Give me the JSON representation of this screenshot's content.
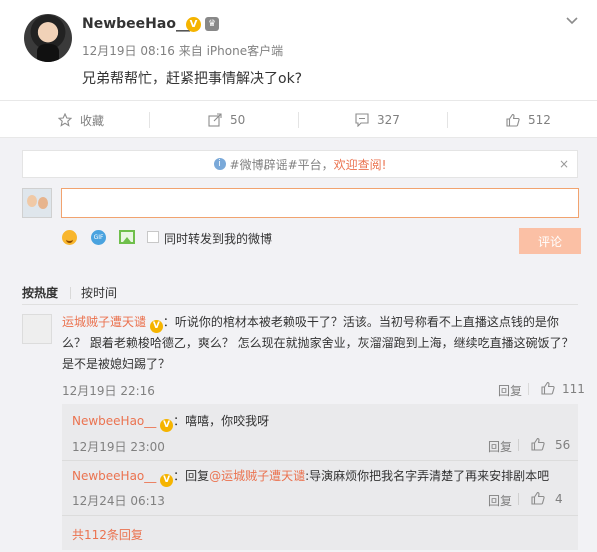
{
  "post": {
    "author": "NewbeeHao__",
    "verified_badge": "V",
    "level_badge": "♛",
    "meta": "12月19日 08:16 来自 iPhone客户端",
    "text": "兄弟帮帮忙，赶紧把事情解决了ok?",
    "more_icon": "chevron-down-icon"
  },
  "actions": {
    "favorite_label": "收藏",
    "repost_count": "50",
    "comment_count": "327",
    "like_count": "512"
  },
  "notice": {
    "prefix": "#微博辟谣#平台，",
    "highlight": "欢迎查阅!",
    "close": "×"
  },
  "composer": {
    "input_value": "",
    "forward_label": "同时转发到我的微博",
    "submit_label": "评论",
    "gif_label": "GIF"
  },
  "sort": {
    "hot_label": "按热度",
    "time_label": "按时间"
  },
  "comment": {
    "author": "运城贼子遭天谴",
    "badge": "V",
    "text": "：听说你的棺材本被老赖吸干了？活该。当初号称看不上直播这点钱的是你么？ 跟着老赖梭哈德乙，爽么？ 怎么现在就抛家舍业，灰溜溜跑到上海，继续吃直播这碗饭了？  是不是被媳妇踢了？",
    "time": "12月19日 22:16",
    "reply_label": "回复",
    "likes": "111"
  },
  "replies": [
    {
      "author": "NewbeeHao__",
      "badge": "V",
      "text": "：嘻嘻，你咬我呀",
      "time": "12月19日 23:00",
      "reply_label": "回复",
      "likes": "56"
    },
    {
      "author": "NewbeeHao__",
      "badge": "V",
      "reply_prefix": "：回复",
      "mention": "@运城贼子遭天谴",
      "text": ":导演麻烦你把我名字弄清楚了再来安排剧本吧",
      "time": "12月24日 06:13",
      "reply_label": "回复",
      "likes": "4"
    }
  ],
  "more_replies": "共112条回复"
}
